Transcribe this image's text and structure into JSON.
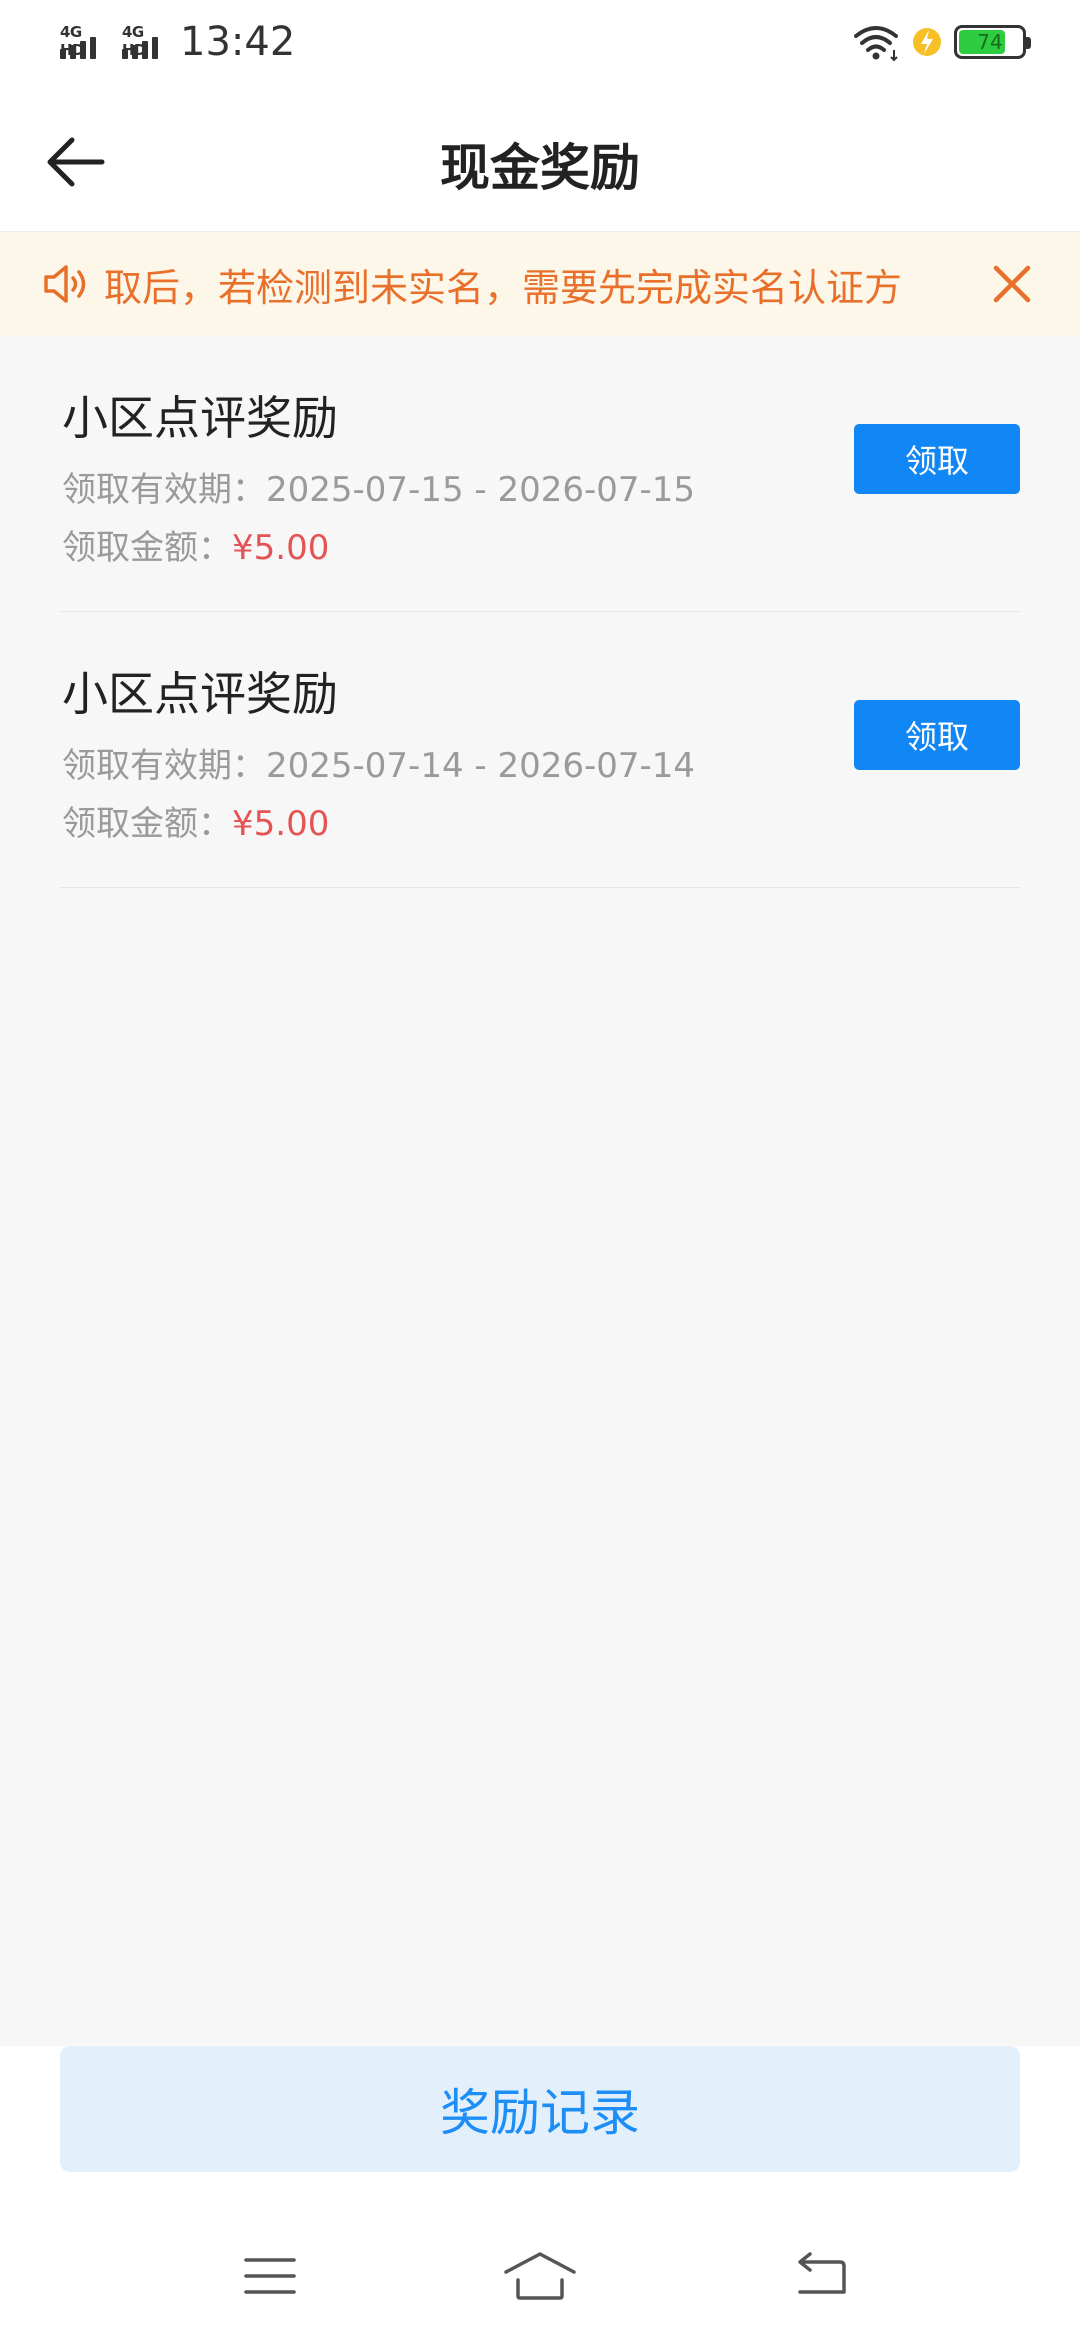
{
  "status_bar": {
    "network_1": "4G HD",
    "network_2": "4G HD",
    "time": "13:42",
    "battery_level": "74",
    "battery_percent": 74,
    "icons": [
      "signal-icon",
      "wifi-icon",
      "charging-icon",
      "battery-icon"
    ]
  },
  "header": {
    "title": "现金奖励",
    "back_icon": "arrow-left-icon"
  },
  "notice": {
    "icon": "speaker-icon",
    "text": "取后，若检测到未实名，需要先完成实名认证方",
    "close_icon": "close-icon"
  },
  "rewards": [
    {
      "title": "小区点评奖励",
      "period_label": "领取有效期：",
      "period_value": "2025-07-15 - 2026-07-15",
      "amount_label": "领取金额：",
      "amount_value": "¥5.00",
      "button_label": "领取"
    },
    {
      "title": "小区点评奖励",
      "period_label": "领取有效期：",
      "period_value": "2025-07-14 - 2026-07-14",
      "amount_label": "领取金额：",
      "amount_value": "¥5.00",
      "button_label": "领取"
    }
  ],
  "footer": {
    "records_label": "奖励记录"
  },
  "system_nav": {
    "icons": [
      "menu-icon",
      "home-icon",
      "back-icon"
    ]
  },
  "colors": {
    "accent": "#1187f5",
    "notice_text": "#e8702a",
    "notice_bg": "#fdf7ea",
    "amount": "#e45454",
    "records_bg": "#e3f0fb"
  }
}
